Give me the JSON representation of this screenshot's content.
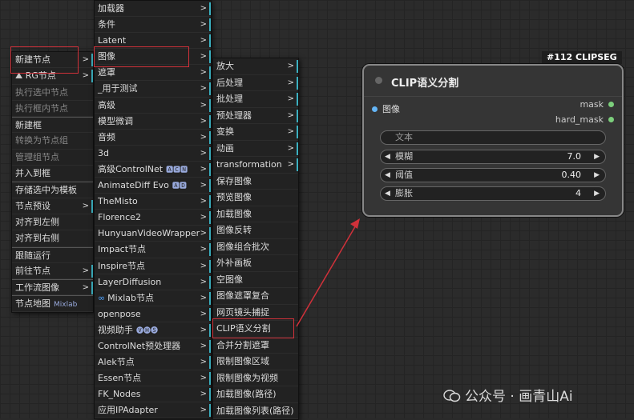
{
  "menu1": {
    "items": [
      {
        "label": "新建节点",
        "has_sub": true
      },
      {
        "label": "RG节点",
        "has_sub": true,
        "icon": "rg-icon"
      },
      {
        "label": "执行选中节点",
        "disabled": true
      },
      {
        "label": "执行框内节点",
        "disabled": true
      },
      {
        "label": "新建框"
      },
      {
        "label": "转换为节点组",
        "disabled": true
      },
      {
        "label": "管理组节点",
        "disabled": true
      },
      {
        "label": "并入到框"
      },
      {
        "label": "存储选中为模板"
      },
      {
        "label": "节点预设",
        "has_sub": true
      },
      {
        "label": "对齐到左侧"
      },
      {
        "label": "对齐到右侧"
      },
      {
        "label": "跟随运行"
      },
      {
        "label": "前往节点",
        "has_sub": true
      },
      {
        "label": "工作流图像",
        "has_sub": true
      },
      {
        "label": "节点地图",
        "extra": "Mixlab"
      }
    ]
  },
  "menu2": {
    "items": [
      {
        "label": "加载器"
      },
      {
        "label": "条件"
      },
      {
        "label": "Latent"
      },
      {
        "label": "图像"
      },
      {
        "label": "遮罩"
      },
      {
        "label": "_用于测试"
      },
      {
        "label": "高级"
      },
      {
        "label": "模型微调"
      },
      {
        "label": "音频"
      },
      {
        "label": "3d"
      },
      {
        "label": "高级ControlNet",
        "extra": "🅰🅲🅽"
      },
      {
        "label": "AnimateDiff Evo",
        "extra": "🅰🅳"
      },
      {
        "label": "TheMisto"
      },
      {
        "label": "Florence2"
      },
      {
        "label": "HunyuanVideoWrapper"
      },
      {
        "label": "Impact节点"
      },
      {
        "label": "Inspire节点"
      },
      {
        "label": "LayerDiffusion"
      },
      {
        "label": "Mixlab节点",
        "prefix": "∞"
      },
      {
        "label": "openpose"
      },
      {
        "label": "视频助手",
        "extra": "🅥🅗🅢"
      },
      {
        "label": "ControlNet预处理器"
      },
      {
        "label": "Alek节点"
      },
      {
        "label": "Essen节点"
      },
      {
        "label": "FK_Nodes"
      },
      {
        "label": "应用IPAdapter"
      }
    ]
  },
  "menu3": {
    "items": [
      {
        "label": "放大",
        "has_sub": true
      },
      {
        "label": "后处理",
        "has_sub": true
      },
      {
        "label": "批处理",
        "has_sub": true
      },
      {
        "label": "预处理器",
        "has_sub": true
      },
      {
        "label": "变换",
        "has_sub": true
      },
      {
        "label": "动画",
        "has_sub": true
      },
      {
        "label": "transformation",
        "has_sub": true
      },
      {
        "label": "保存图像"
      },
      {
        "label": "预览图像"
      },
      {
        "label": "加载图像"
      },
      {
        "label": "图像反转"
      },
      {
        "label": "图像组合批次"
      },
      {
        "label": "外补画板"
      },
      {
        "label": "空图像"
      },
      {
        "label": "图像遮罩复合"
      },
      {
        "label": "网页镜头捕捉"
      },
      {
        "label": "CLIP语义分割"
      },
      {
        "label": "合并分割遮罩"
      },
      {
        "label": "限制图像区域"
      },
      {
        "label": "限制图像为视频"
      },
      {
        "label": "加载图像(路径)"
      },
      {
        "label": "加载图像列表(路径)"
      }
    ]
  },
  "node": {
    "badge": "#112 CLIPSEG",
    "title": "CLIP语义分割",
    "input": "图像",
    "outputs": [
      "mask",
      "hard_mask"
    ],
    "text_placeholder": "文本",
    "widgets": [
      {
        "label": "模糊",
        "value": "7.0"
      },
      {
        "label": "阈值",
        "value": "0.40"
      },
      {
        "label": "膨胀",
        "value": "4"
      }
    ]
  },
  "watermark": "公众号 · 画青山Ai",
  "colors": {
    "highlight": "#d0313a",
    "accent": "#3bb0c0",
    "mask_dot": "#7ccf7c",
    "image_dot": "#64b5f6"
  }
}
